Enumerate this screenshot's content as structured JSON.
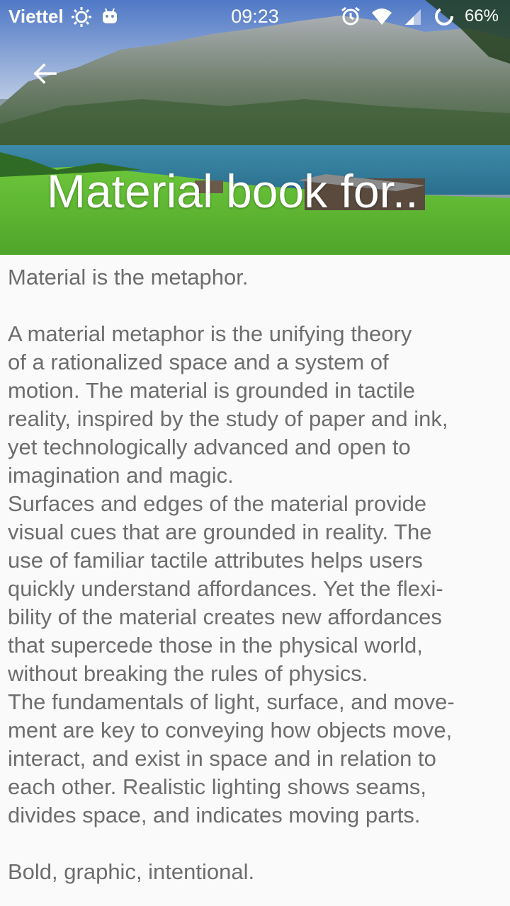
{
  "status_bar": {
    "carrier": "Viettel",
    "time": "09:23",
    "battery": "66%"
  },
  "header": {
    "title": "Material book for..",
    "back_icon": "arrow-back-icon"
  },
  "content": {
    "paragraphs": [
      "Material is the metaphor.\n\n A material metaphor is the unifying theory\nof a rationalized space and a system of\nmotion. The material is grounded in tactile\nreality, inspired by the study of paper and ink,\nyet  technologically advanced and open to\nimagination and magic.\n Surfaces and edges of the material provide\nvisual cues that are grounded in reality. The\nuse of familiar tactile attributes helps users\nquickly understand affordances. Yet the  flexi-\nbility of the material creates new affordances\nthat supercede those in the physical  world,\nwithout breaking the rules of physics.\n The fundamentals of light, surface, and move-\nment are key to conveying how objects move,\ninteract, and exist in space and in relation to\neach other. Realistic lighting shows  seams,\ndivides space, and indicates moving parts.\n\n Bold, graphic, intentional."
    ]
  }
}
